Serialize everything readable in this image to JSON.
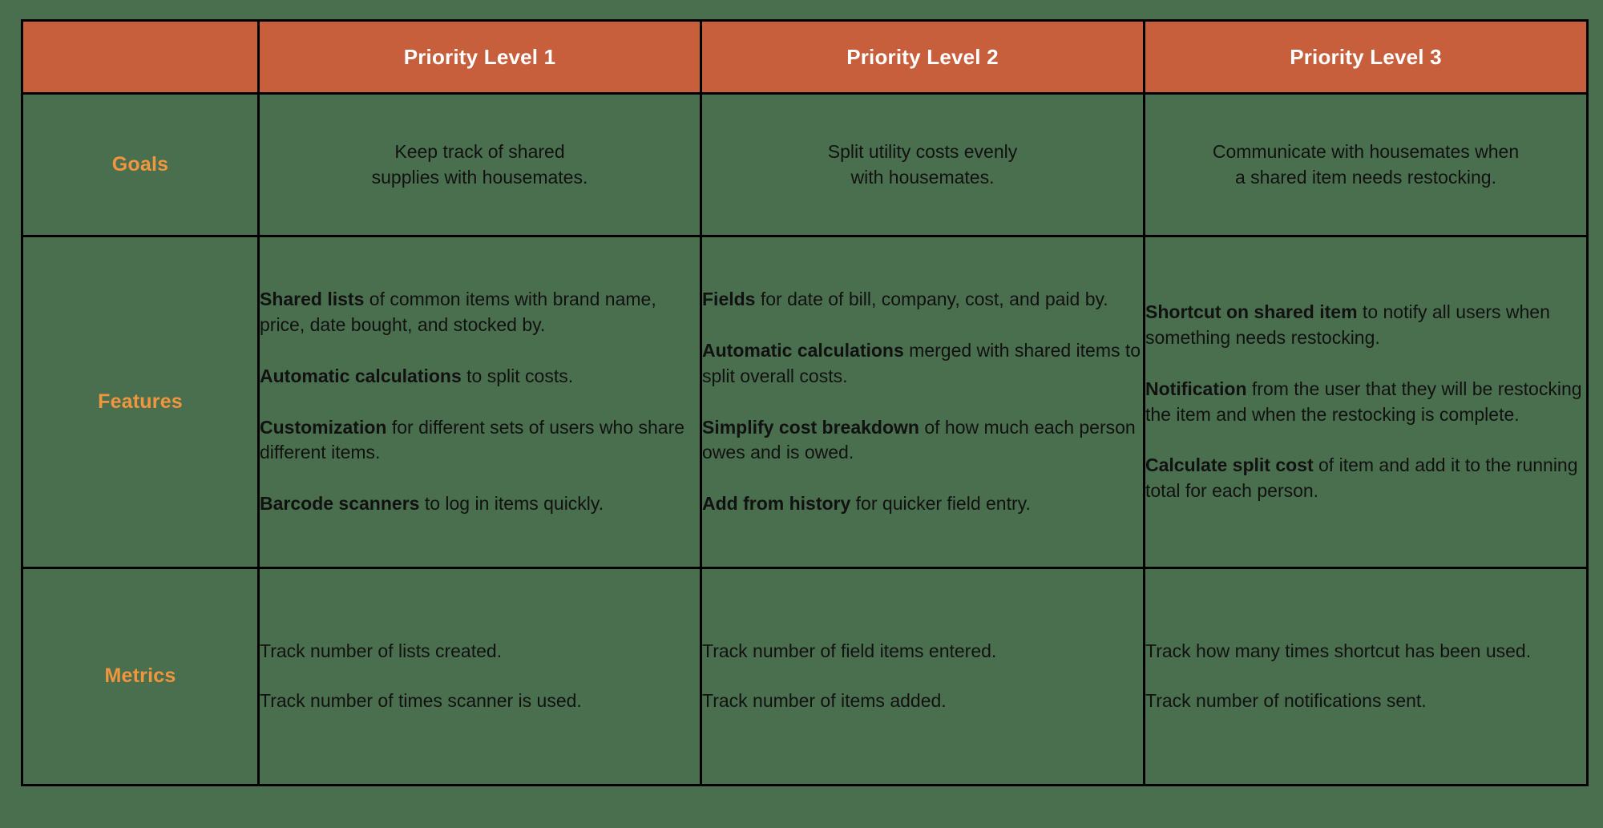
{
  "page": {
    "background_color": "#4a6f4e",
    "header_color": "#c85f3c",
    "label_color": "#f0963f",
    "border_color": "#000000",
    "body_text_color": "#111111",
    "header_text_color": "#ffffff"
  },
  "table": {
    "corner_label": "",
    "columns": [
      {
        "id": "p1",
        "label": "Priority Level 1"
      },
      {
        "id": "p2",
        "label": "Priority Level 2"
      },
      {
        "id": "p3",
        "label": "Priority Level 3"
      }
    ],
    "rows": [
      {
        "id": "goals",
        "label": "Goals",
        "align": "center",
        "cells": [
          {
            "paragraphs": [
              {
                "lead": "",
                "text": "Keep track of shared\nsupplies with housemates."
              }
            ]
          },
          {
            "paragraphs": [
              {
                "lead": "",
                "text": "Split utility costs evenly\nwith housemates."
              }
            ]
          },
          {
            "paragraphs": [
              {
                "lead": "",
                "text": "Communicate with housemates when\na shared item needs restocking."
              }
            ]
          }
        ]
      },
      {
        "id": "features",
        "label": "Features",
        "align": "left",
        "cells": [
          {
            "paragraphs": [
              {
                "lead": "Shared lists",
                "text": " of common items with brand name, price, date bought, and stocked by."
              },
              {
                "lead": "Automatic calculations",
                "text": " to split costs."
              },
              {
                "lead": "Customization",
                "text": " for different sets of users who share different items."
              },
              {
                "lead": "Barcode scanners",
                "text": " to log in items quickly."
              }
            ]
          },
          {
            "paragraphs": [
              {
                "lead": "Fields",
                "text": " for date of bill, company, cost, and paid by."
              },
              {
                "lead": "Automatic calculations",
                "text": " merged with shared items to split overall costs."
              },
              {
                "lead": "Simplify cost breakdown",
                "text": " of how much each person owes and is owed."
              },
              {
                "lead": "Add from history",
                "text": " for quicker field entry."
              }
            ]
          },
          {
            "paragraphs": [
              {
                "lead": "Shortcut on shared item",
                "text": " to notify all users when something needs restocking."
              },
              {
                "lead": "Notification",
                "text": " from the user that they will be restocking the item and when the restocking is complete."
              },
              {
                "lead": "Calculate split cost",
                "text": " of item and add it to the running total for each person."
              }
            ]
          }
        ]
      },
      {
        "id": "metrics",
        "label": "Metrics",
        "align": "left",
        "cells": [
          {
            "paragraphs": [
              {
                "lead": "",
                "text": "Track number of lists created."
              },
              {
                "lead": "",
                "text": "Track number of times scanner is used."
              }
            ]
          },
          {
            "paragraphs": [
              {
                "lead": "",
                "text": "Track number of field items entered."
              },
              {
                "lead": "",
                "text": "Track number of items added."
              }
            ]
          },
          {
            "paragraphs": [
              {
                "lead": "",
                "text": "Track how many times shortcut has been used."
              },
              {
                "lead": "",
                "text": "Track number of notifications sent."
              }
            ]
          }
        ]
      }
    ]
  }
}
